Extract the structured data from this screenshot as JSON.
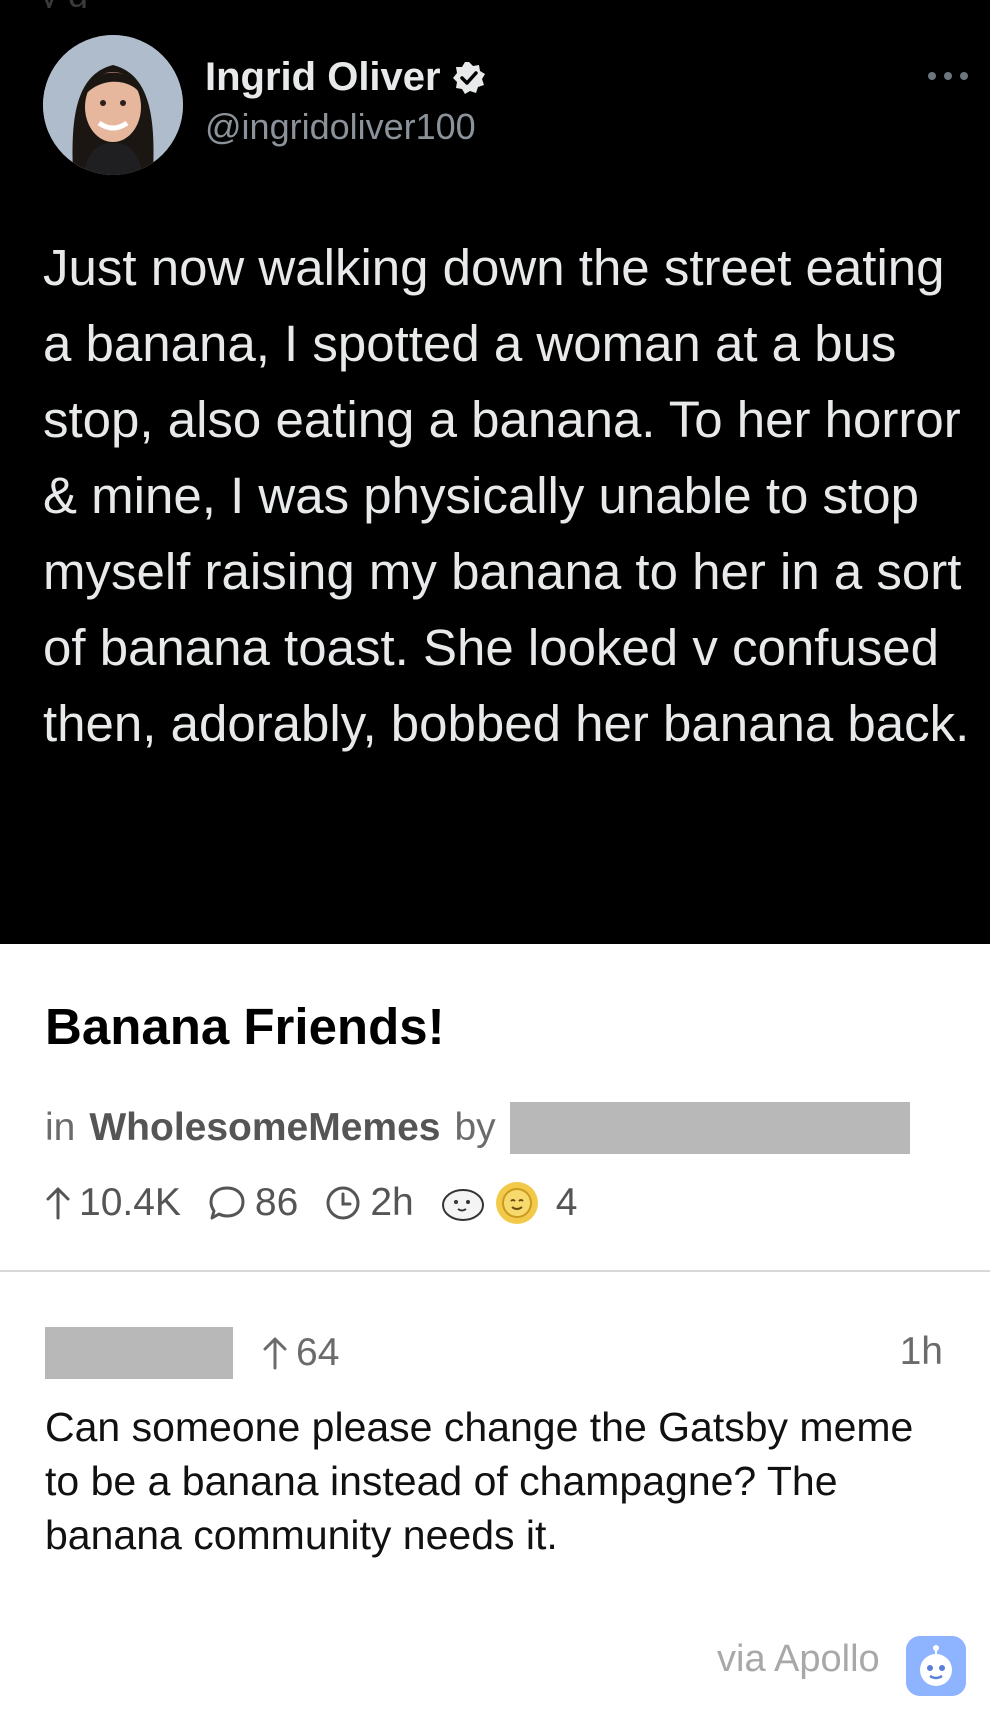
{
  "tweet": {
    "author_name": "Ingrid Oliver",
    "handle": "@ingridoliver100",
    "text": "Just now walking down the street eating a banana, I spotted a woman at a bus stop, also eating a banana. To her horror & mine, I was physically unable to stop myself raising my banana to her in a sort of banana toast. She looked v confused then, adorably, bobbed her banana back.",
    "more_icon": "ellipsis-icon",
    "verified_icon": "verified-badge-icon"
  },
  "post": {
    "title": "Banana Friends!",
    "in_label": "in",
    "subreddit": "WholesomeMemes",
    "by_label": "by",
    "upvotes": "10.4K",
    "comments": "86",
    "age": "2h",
    "award_count": "4",
    "icons": {
      "upvote": "arrow-up-icon",
      "comments": "speech-bubble-icon",
      "age": "clock-icon",
      "awards": [
        "wholesome-seal-award-icon",
        "sun-award-icon"
      ]
    }
  },
  "comment": {
    "score": "64",
    "time": "1h",
    "text": "Can someone please change the Gatsby meme to be a banana instead of champagne? The banana community needs it."
  },
  "footer": {
    "via_text": "via Apollo",
    "app_icon": "apollo-app-icon"
  },
  "colors": {
    "tweet_background": "#000000",
    "tweet_text": "#e7e9ea",
    "verified_badge": "#e7e9ea",
    "meta_gray": "#6b6b6b",
    "redaction_gray": "#b8b8b8",
    "award_gold": "#e0b339",
    "apollo_blue": "#8fb4ff"
  }
}
